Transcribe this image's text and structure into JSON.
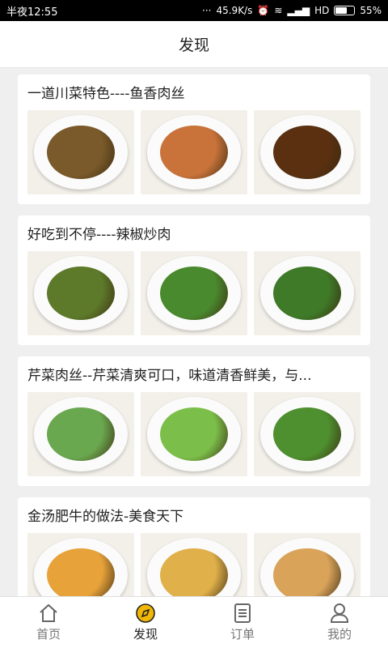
{
  "status": {
    "time": "半夜12:55",
    "speed": "45.9K/s",
    "network": "HD",
    "battery": "55%",
    "battery_level": 0.55
  },
  "header": {
    "title": "发现"
  },
  "cards": [
    {
      "title": "一道川菜特色----鱼香肉丝",
      "images": [
        "dish-image",
        "dish-image",
        "dish-image"
      ],
      "colors": [
        "#7a5a2a",
        "#c9733a",
        "#5a3010"
      ]
    },
    {
      "title": "好吃到不停----辣椒炒肉",
      "images": [
        "dish-image",
        "dish-image",
        "dish-image"
      ],
      "colors": [
        "#5d7a2a",
        "#4a8a2e",
        "#3e7a28"
      ]
    },
    {
      "title": "芹菜肉丝--芹菜清爽可口，味道清香鲜美，与...",
      "images": [
        "dish-image",
        "dish-image",
        "dish-image"
      ],
      "colors": [
        "#6aa84f",
        "#7bbf4a",
        "#4e8f2f"
      ]
    },
    {
      "title": "金汤肥牛的做法-美食天下",
      "images": [
        "dish-image",
        "dish-image",
        "dish-image"
      ],
      "colors": [
        "#e7a23a",
        "#e0b04a",
        "#d9a35a"
      ]
    }
  ],
  "tabbar": {
    "home": "首页",
    "discover": "发现",
    "orders": "订单",
    "mine": "我的",
    "active": "discover",
    "accent": "#f2b705"
  }
}
